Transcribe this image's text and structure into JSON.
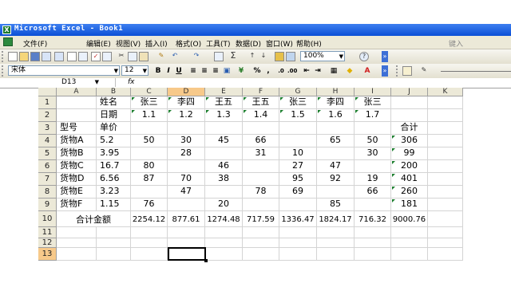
{
  "window": {
    "title": "Microsoft Excel - Book1",
    "app_icon": "X"
  },
  "menu": {
    "items": [
      "文件(F)",
      "编辑(E)",
      "视图(V)",
      "插入(I)",
      "格式(O)",
      "工具(T)",
      "数据(D)",
      "窗口(W)",
      "帮助(H)"
    ],
    "help_box": "键入"
  },
  "toolbar": {
    "zoom": "100%",
    "font_name": "宋体",
    "font_size": "12",
    "bold": "B",
    "italic": "I",
    "underline": "U",
    "percent": "%",
    "comma": ",",
    "sum": "Σ"
  },
  "formula_bar": {
    "name_box": "D13",
    "fx": "fx",
    "content": ""
  },
  "columns": [
    "A",
    "B",
    "C",
    "D",
    "E",
    "F",
    "G",
    "H",
    "I",
    "J",
    "K"
  ],
  "rows": [
    "1",
    "2",
    "3",
    "4",
    "5",
    "6",
    "7",
    "8",
    "9",
    "10",
    "11",
    "12",
    "13"
  ],
  "selected_cell": "D13",
  "sheet": {
    "r1": {
      "B": "姓名",
      "C": "张三",
      "D": "李四",
      "E": "王五",
      "F": "王五",
      "G": "张三",
      "H": "李四",
      "I": "张三"
    },
    "r2": {
      "B": "日期",
      "C": "1.1",
      "D": "1.2",
      "E": "1.3",
      "F": "1.4",
      "G": "1.5",
      "H": "1.6",
      "I": "1.7"
    },
    "r3": {
      "A": "型号",
      "B": "单价",
      "J": "合计"
    },
    "r4": {
      "A": "货物A",
      "B": "5.2",
      "C": "50",
      "D": "30",
      "E": "45",
      "F": "66",
      "H": "65",
      "I": "50",
      "J": "306"
    },
    "r5": {
      "A": "货物B",
      "B": "3.95",
      "D": "28",
      "F": "31",
      "G": "10",
      "I": "30",
      "J": "99"
    },
    "r6": {
      "A": "货物C",
      "B": "16.7",
      "C": "80",
      "E": "46",
      "G": "27",
      "H": "47",
      "J": "200"
    },
    "r7": {
      "A": "货物D",
      "B": "6.56",
      "C": "87",
      "D": "70",
      "E": "38",
      "G": "95",
      "H": "92",
      "I": "19",
      "J": "401"
    },
    "r8": {
      "A": "货物E",
      "B": "3.23",
      "D": "47",
      "F": "78",
      "G": "69",
      "I": "66",
      "J": "260"
    },
    "r9": {
      "A": "货物F",
      "B": "1.15",
      "C": "76",
      "E": "20",
      "H": "85",
      "J": "181"
    },
    "r10": {
      "AB": "合计金额",
      "C": "2254.12",
      "D": "877.61",
      "E": "1274.48",
      "F": "717.59",
      "G": "1336.47",
      "H": "1824.17",
      "I": "716.32",
      "J": "9000.76"
    }
  }
}
